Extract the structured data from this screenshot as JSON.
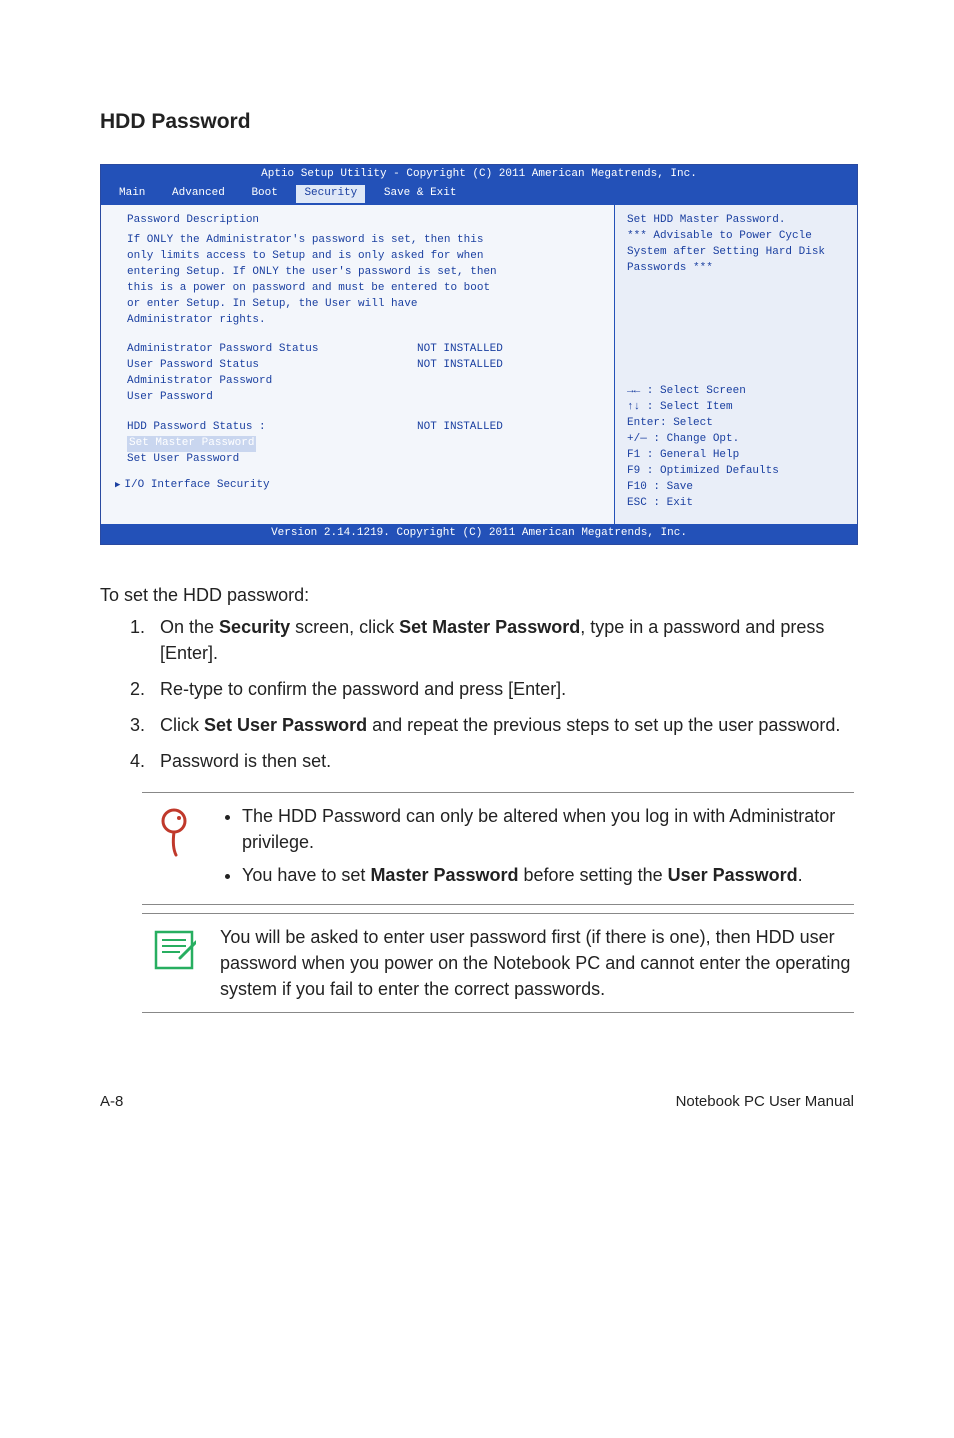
{
  "heading": "HDD Password",
  "bios": {
    "titlebar": "Aptio Setup Utility - Copyright (C) 2011 American Megatrends, Inc.",
    "tabs": [
      "Main",
      "Advanced",
      "Boot",
      "Security",
      "Save & Exit"
    ],
    "active_tab": "Security",
    "desc_title": "Password Description",
    "desc_body": "If ONLY the Administrator's password is set, then this only limits access to Setup and is only asked for when entering Setup. If ONLY the user's password is set, then this is a power on password and must be entered to boot or enter Setup. In Setup, the User will have Administrator rights.",
    "rows": [
      {
        "label": "Administrator Password Status",
        "value": "NOT INSTALLED"
      },
      {
        "label": "User Password Status",
        "value": "NOT INSTALLED"
      }
    ],
    "link_rows": [
      "Administrator Password",
      "User Password"
    ],
    "hdd_row": {
      "label": "HDD Password Status :",
      "value": "NOT INSTALLED"
    },
    "hdd_links": [
      "Set Master Password",
      "Set User Password"
    ],
    "io_link": "I/O Interface Security",
    "help_top1": "Set HDD Master Password.",
    "help_top2": "*** Advisable to Power Cycle System after Setting Hard Disk Passwords ***",
    "help_keys": [
      "→←  : Select Screen",
      "↑↓    : Select Item",
      "Enter: Select",
      "+/—  : Change Opt.",
      "F1    : General Help",
      "F9    : Optimized Defaults",
      "F10  : Save",
      "ESC  : Exit"
    ],
    "footer": "Version 2.14.1219. Copyright (C) 2011 American Megatrends, Inc."
  },
  "intro": "To set the HDD password:",
  "steps": {
    "s1a": "On the ",
    "s1b": "Security",
    "s1c": " screen, click ",
    "s1d": "Set Master Password",
    "s1e": ", type in a password and press [Enter].",
    "s2": "Re-type to confirm the password and press [Enter].",
    "s3a": "Click ",
    "s3b": "Set User Password",
    "s3c": " and repeat the previous steps to set up the user password.",
    "s4": "Password is then set."
  },
  "tipA": {
    "li1": "The HDD Password can only be altered when you log in with Administrator privilege.",
    "li2a": "You have to set ",
    "li2b": "Master Password",
    "li2c": " before setting the ",
    "li2d": "User Password",
    "li2e": "."
  },
  "tipB": "You will be asked to enter user password first (if there is one), then HDD user password when you power on the Notebook PC and cannot enter the operating system if you fail to enter the correct passwords.",
  "footer_left": "A-8",
  "footer_right": "Notebook PC User Manual"
}
